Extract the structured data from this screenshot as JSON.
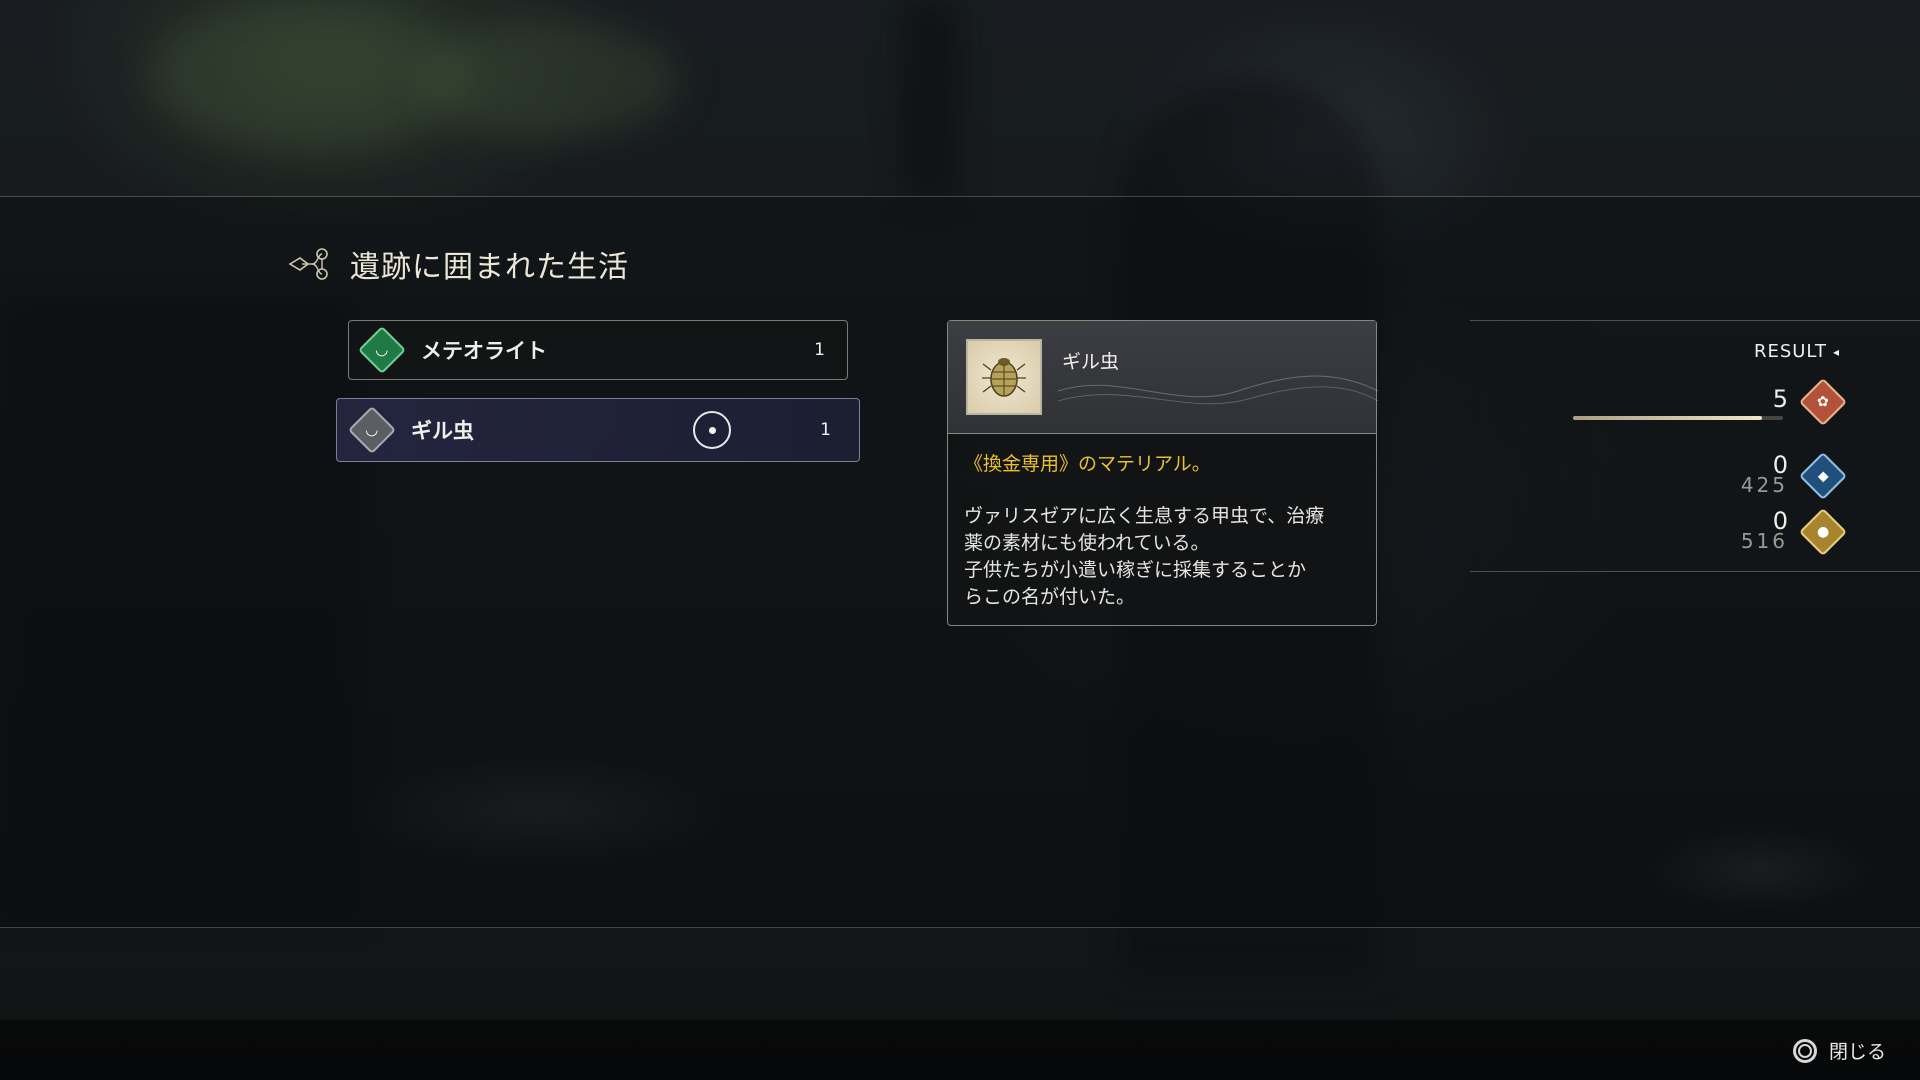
{
  "quest": {
    "title": "遺跡に囲まれた生活",
    "emblem_icon": "ornate-emblem-icon"
  },
  "items": [
    {
      "name": "メテオライト",
      "count": "1",
      "icon": "bowl-icon",
      "color": "#1f7a45"
    },
    {
      "name": "ギル虫",
      "count": "1",
      "icon": "bowl-icon",
      "color": "#5b5e63",
      "selected": true
    }
  ],
  "detail": {
    "name": "ギル虫",
    "thumbnail_icon": "beetle-icon",
    "tag": "《換金専用》のマテリアル。",
    "description": "ヴァリスゼアに広く生息する甲虫で、治療\n薬の素材にも使われている。\n子供たちが小遣い稼ぎに採集することか\nらこの名が付いた。"
  },
  "result": {
    "title": "RESULT",
    "rows": [
      {
        "value": "5",
        "icon": "red-gem-icon",
        "progress": 0.9
      },
      {
        "value": "0",
        "sub": "425",
        "icon": "blue-gem-icon"
      },
      {
        "value": "0",
        "sub": "516",
        "icon": "gold-coin-icon"
      }
    ]
  },
  "footer": {
    "close_label": "閉じる",
    "close_button_icon": "circle-button-icon"
  }
}
